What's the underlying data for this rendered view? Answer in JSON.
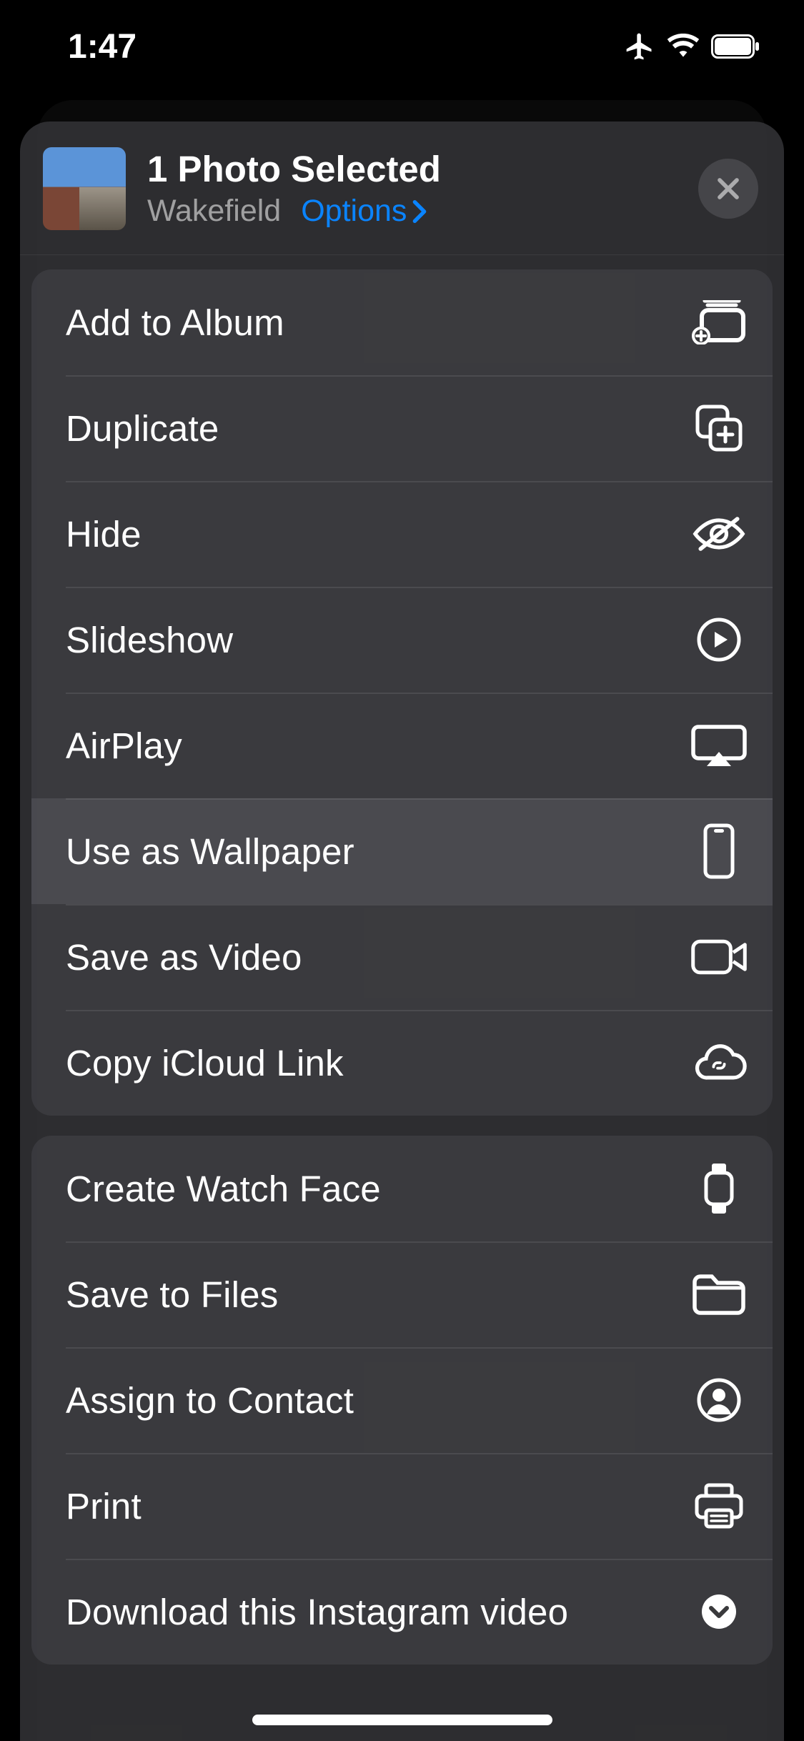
{
  "status": {
    "time": "1:47"
  },
  "header": {
    "title": "1 Photo Selected",
    "subtitle": "Wakefield",
    "options_label": "Options"
  },
  "groups": [
    {
      "rows": [
        {
          "label": "Add to Album",
          "icon": "album-add-icon",
          "highlight": false
        },
        {
          "label": "Duplicate",
          "icon": "duplicate-icon",
          "highlight": false
        },
        {
          "label": "Hide",
          "icon": "eye-slash-icon",
          "highlight": false
        },
        {
          "label": "Slideshow",
          "icon": "play-circle-icon",
          "highlight": false
        },
        {
          "label": "AirPlay",
          "icon": "airplay-icon",
          "highlight": false
        },
        {
          "label": "Use as Wallpaper",
          "icon": "phone-icon",
          "highlight": true
        },
        {
          "label": "Save as Video",
          "icon": "video-icon",
          "highlight": false
        },
        {
          "label": "Copy iCloud Link",
          "icon": "cloud-link-icon",
          "highlight": false
        }
      ]
    },
    {
      "rows": [
        {
          "label": "Create Watch Face",
          "icon": "watch-icon",
          "highlight": false
        },
        {
          "label": "Save to Files",
          "icon": "folder-icon",
          "highlight": false
        },
        {
          "label": "Assign to Contact",
          "icon": "person-circle-icon",
          "highlight": false
        },
        {
          "label": "Print",
          "icon": "print-icon",
          "highlight": false
        },
        {
          "label": "Download this Instagram video",
          "icon": "chevron-circle-icon",
          "highlight": false
        }
      ]
    }
  ]
}
